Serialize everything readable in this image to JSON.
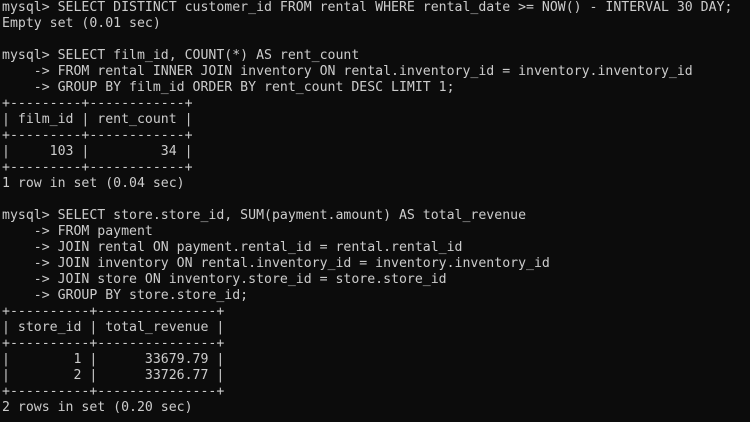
{
  "terminal": {
    "lines": [
      "mysql> SELECT DISTINCT customer_id FROM rental WHERE rental_date >= NOW() - INTERVAL 30 DAY;",
      "Empty set (0.01 sec)",
      "",
      "mysql> SELECT film_id, COUNT(*) AS rent_count",
      "    -> FROM rental INNER JOIN inventory ON rental.inventory_id = inventory.inventory_id",
      "    -> GROUP BY film_id ORDER BY rent_count DESC LIMIT 1;",
      "+---------+------------+",
      "| film_id | rent_count |",
      "+---------+------------+",
      "|     103 |         34 |",
      "+---------+------------+",
      "1 row in set (0.04 sec)",
      "",
      "mysql> SELECT store.store_id, SUM(payment.amount) AS total_revenue",
      "    -> FROM payment",
      "    -> JOIN rental ON payment.rental_id = rental.rental_id",
      "    -> JOIN inventory ON rental.inventory_id = inventory.inventory_id",
      "    -> JOIN store ON inventory.store_id = store.store_id",
      "    -> GROUP BY store.store_id;",
      "+----------+---------------+",
      "| store_id | total_revenue |",
      "+----------+---------------+",
      "|        1 |      33679.79 |",
      "|        2 |      33726.77 |",
      "+----------+---------------+",
      "2 rows in set (0.20 sec)"
    ]
  },
  "colors": {
    "background": "#0c0c0c",
    "text": "#cccccc"
  }
}
